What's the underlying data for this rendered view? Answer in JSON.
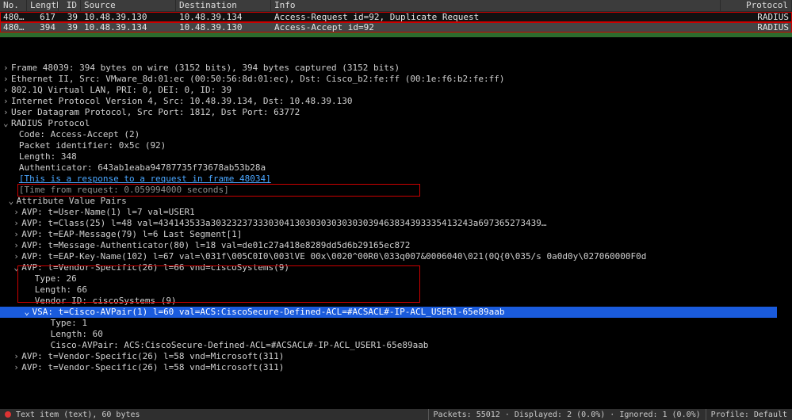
{
  "columns": {
    "no": "No.",
    "length": "Length",
    "id": "ID",
    "source": "Source",
    "destination": "Destination",
    "info": "Info",
    "protocol": "Protocol"
  },
  "packets": [
    {
      "no": "480…",
      "length": "617",
      "id": "39",
      "source": "10.48.39.130",
      "destination": "10.48.39.134",
      "info": "Access-Request id=92, Duplicate Request",
      "protocol": "RADIUS"
    },
    {
      "no": "480…",
      "length": "394",
      "id": "39",
      "source": "10.48.39.134",
      "destination": "10.48.39.130",
      "info": "Access-Accept id=92",
      "protocol": "RADIUS"
    }
  ],
  "details": {
    "frame": "Frame 48039: 394 bytes on wire (3152 bits), 394 bytes captured (3152 bits)",
    "eth": "Ethernet II, Src: VMware_8d:01:ec (00:50:56:8d:01:ec), Dst: Cisco_b2:fe:ff (00:1e:f6:b2:fe:ff)",
    "vlan": "802.1Q Virtual LAN, PRI: 0, DEI: 0, ID: 39",
    "ip": "Internet Protocol Version 4, Src: 10.48.39.134, Dst: 10.48.39.130",
    "udp": "User Datagram Protocol, Src Port: 1812, Dst Port: 63772",
    "radius_header": "RADIUS Protocol",
    "code": "Code: Access-Accept (2)",
    "packet_id": "Packet identifier: 0x5c (92)",
    "length": "Length: 348",
    "authenticator": "Authenticator: 643ab1eaba94787735f73678ab53b28a",
    "response_link": "[This is a response to a request in frame 48034]",
    "time_from_request": "[Time from request: 0.059994000 seconds]",
    "avp_header": "Attribute Value Pairs",
    "avp_user": "AVP: t=User-Name(1) l=7 val=USER1",
    "avp_class": "AVP: t=Class(25) l=48 val=434143533a30323237333030413030303030303039463834393335413243a697365273439…",
    "avp_eap": "AVP: t=EAP-Message(79) l=6 Last Segment[1]",
    "avp_msg_auth": "AVP: t=Message-Authenticator(80) l=18 val=de01c27a418e8289dd5d6b29165ec872",
    "avp_eap_key": "AVP: t=EAP-Key-Name(102) l=67 val=\\031f\\005C0I0\\003lVE 00x\\0020^00R0\\033q007&0006040\\021(0Q{0\\035/s 0a0d0y\\027060000F0d",
    "avp_vendor_cisco": "AVP: t=Vendor-Specific(26) l=66 vnd=ciscoSystems(9)",
    "vsp_type": "Type: 26",
    "vsp_length": "Length: 66",
    "vsp_vendor": "Vendor ID: ciscoSystems (9)",
    "vsa_line": "VSA: t=Cisco-AVPair(1) l=60 val=ACS:CiscoSecure-Defined-ACL=#ACSACL#-IP-ACL_USER1-65e89aab",
    "vsa_type": "Type: 1",
    "vsa_length": "Length: 60",
    "vsa_cisco": "Cisco-AVPair: ACS:CiscoSecure-Defined-ACL=#ACSACL#-IP-ACL_USER1-65e89aab",
    "avp_vendor_ms1": "AVP: t=Vendor-Specific(26) l=58 vnd=Microsoft(311)",
    "avp_vendor_ms2": "AVP: t=Vendor-Specific(26) l=58 vnd=Microsoft(311)"
  },
  "status": {
    "item": "Text item (text), 60 bytes",
    "packets": "Packets: 55012 · Displayed: 2 (0.0%) · Ignored: 1 (0.0%)",
    "profile": "Profile: Default"
  },
  "expanders": {
    "closed": "›",
    "open": "⌄"
  }
}
